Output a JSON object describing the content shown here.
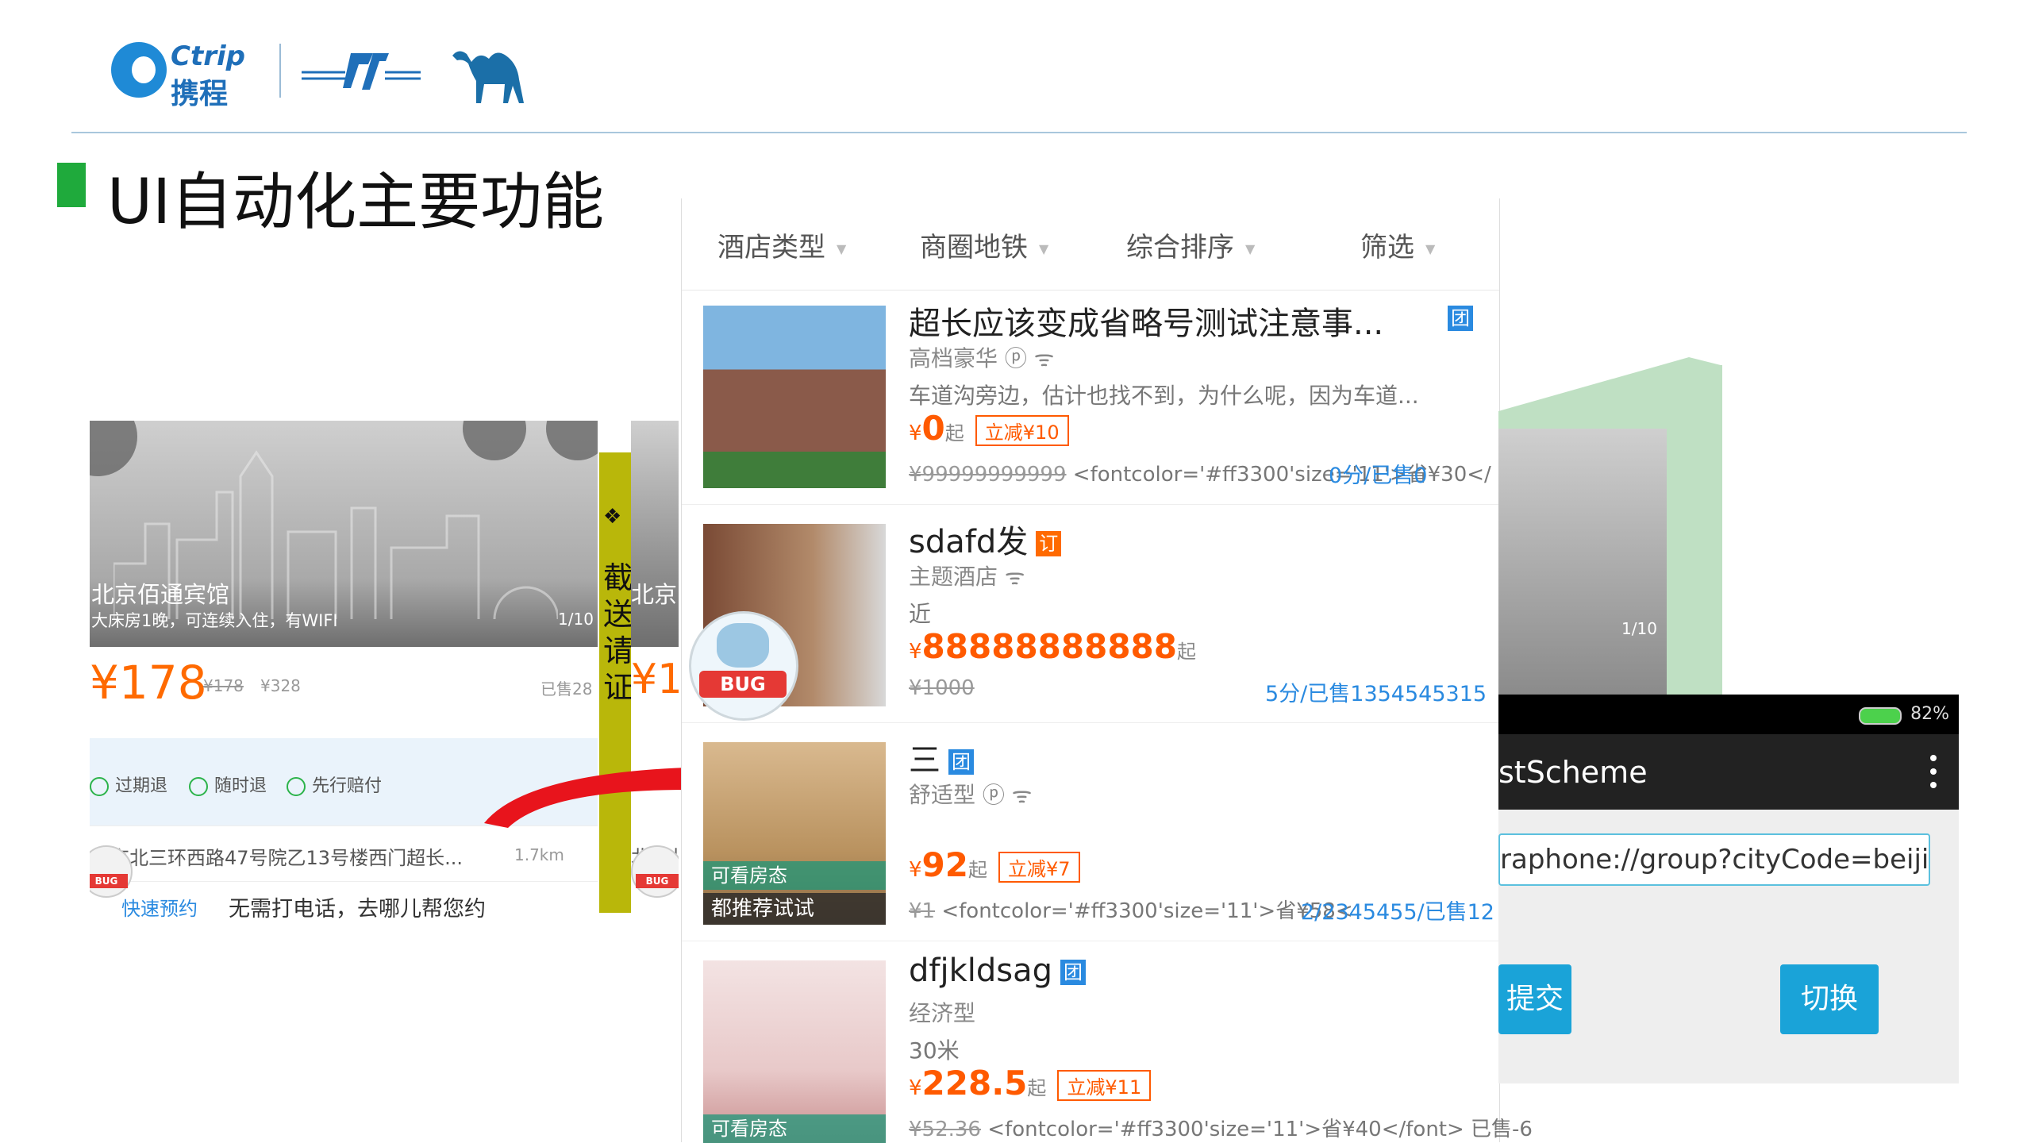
{
  "header": {
    "ctrip_en": "Ctrip",
    "ctrip_cn": "携程",
    "title": "UI自动化主要功能"
  },
  "colors": {
    "accent": "#1faa3c",
    "price": "#ff5a00",
    "link": "#2a8ae0",
    "fold": "#b9b70a"
  },
  "left_app": {
    "hotel_name": "北京佰通宾馆",
    "hotel_desc": "大床房1晚，可连续入住，有WIFI",
    "photo_count": "1/10",
    "price": "¥178",
    "price_old1": "¥178",
    "price_old2": "¥328",
    "sold": "已售28",
    "policies": [
      "过期退",
      "随时退",
      "先行赔付"
    ],
    "address": "北京北三环西路47号院乙13号楼西门超长...",
    "distance": "1.7km",
    "book_link": "快速预约",
    "book_text": "无需打电话，去哪儿帮您约",
    "bug_label": "BUG"
  },
  "left_app2": {
    "name": "北京",
    "price": "¥1",
    "address": "北京北"
  },
  "fold_panel": {
    "bullet": "❖",
    "text": "截送请证"
  },
  "list": {
    "filters": [
      "酒店类型",
      "商圈地铁",
      "综合排序",
      "筛选"
    ],
    "hotels": [
      {
        "name": "超长应该变成省略号测试注意事...",
        "tag": "团",
        "type": "高档豪华 ⓟ ᯤ",
        "location": "车道沟旁边，估计也找不到，为什么呢，因为车道...",
        "price_prefix": "¥",
        "price": "0",
        "price_suffix": "起",
        "discount": "立减¥10",
        "original": "¥99999999999",
        "note": " <fontcolor='#ff3300'size='11'>省¥30</",
        "score": "0分/已售0"
      },
      {
        "name": "sdafd发",
        "tag": "订",
        "type": "主题酒店 ᯤ",
        "location": "近",
        "price_prefix": "¥",
        "price": "88888888888",
        "price_suffix": "起",
        "discount": "",
        "original": "¥1000",
        "note": "",
        "score": "5分/已售1354545315"
      },
      {
        "name": "三",
        "tag": "团",
        "type": "舒适型 ⓟ ᯤ",
        "location": "",
        "price_prefix": "¥",
        "price": "92",
        "price_suffix": "起",
        "discount": "立减¥7",
        "original": "¥1",
        "note": " <fontcolor='#ff3300'size='11'>省¥58<",
        "score": "2/2345455/已售12",
        "photo_label1": "可看房态",
        "photo_label2": "都推荐试试"
      },
      {
        "name": "dfjkldsag",
        "tag": "团",
        "type": "经济型",
        "location": "30米",
        "price_prefix": "¥",
        "price": "228.5",
        "price_suffix": "起",
        "discount": "立减¥11",
        "original": "¥52.36",
        "note": " <fontcolor='#ff3300'size='11'>省¥40</font> 已售-6",
        "score": "",
        "photo_label1": "可看房态"
      }
    ],
    "bug_label": "BUG"
  },
  "right_app": {
    "photo_count": "1/10",
    "battery": "82%",
    "app_title": "stScheme",
    "scheme_value": "raphone://group?cityCode=beijing",
    "submit_label": "提交",
    "switch_label": "切换"
  }
}
